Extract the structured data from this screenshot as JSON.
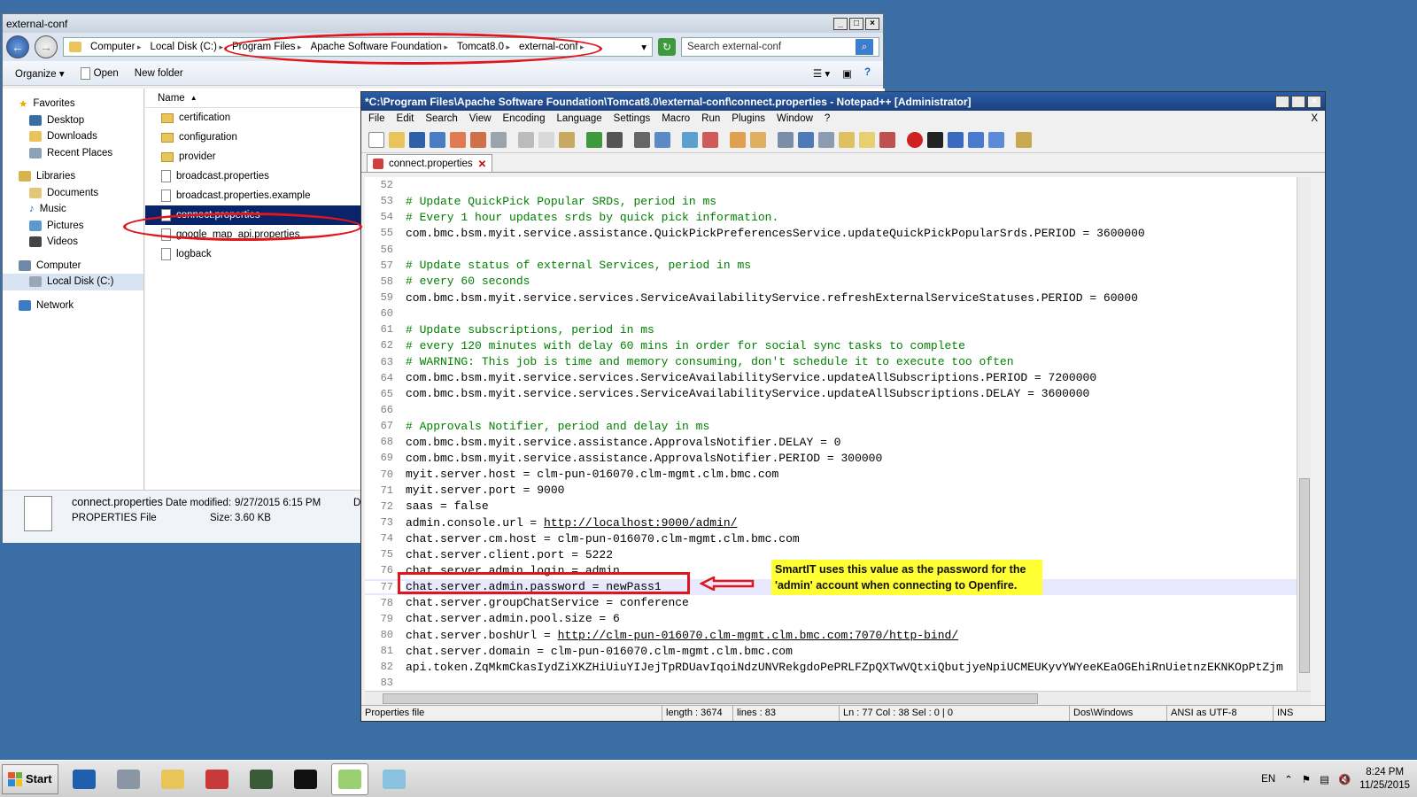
{
  "explorer": {
    "title": "external-conf",
    "breadcrumb": [
      "Computer",
      "Local Disk (C:)",
      "Program Files",
      "Apache Software Foundation",
      "Tomcat8.0",
      "external-conf"
    ],
    "search_placeholder": "Search external-conf",
    "commands": {
      "organize": "Organize ▾",
      "open": "Open",
      "new_folder": "New folder"
    },
    "nav": {
      "favorites": "Favorites",
      "desktop": "Desktop",
      "downloads": "Downloads",
      "recent": "Recent Places",
      "libraries": "Libraries",
      "documents": "Documents",
      "music": "Music",
      "pictures": "Pictures",
      "videos": "Videos",
      "computer": "Computer",
      "local_disk": "Local Disk (C:)",
      "network": "Network"
    },
    "column_name": "Name",
    "files": [
      {
        "name": "certification",
        "kind": "folder"
      },
      {
        "name": "configuration",
        "kind": "folder"
      },
      {
        "name": "provider",
        "kind": "folder"
      },
      {
        "name": "broadcast.properties",
        "kind": "doc"
      },
      {
        "name": "broadcast.properties.example",
        "kind": "doc"
      },
      {
        "name": "connect.properties",
        "kind": "doc"
      },
      {
        "name": "google_map_api.properties",
        "kind": "doc"
      },
      {
        "name": "logback",
        "kind": "doc"
      }
    ],
    "details": {
      "filename": "connect.properties",
      "date_label": "Date modified:",
      "date_value": "9/27/2015 6:15 PM",
      "type": "PROPERTIES File",
      "size_label": "Size:",
      "size_value": "3.60 KB",
      "extra": "D"
    }
  },
  "notepad": {
    "title": "*C:\\Program Files\\Apache Software Foundation\\Tomcat8.0\\external-conf\\connect.properties - Notepad++ [Administrator]",
    "menus": [
      "File",
      "Edit",
      "Search",
      "View",
      "Encoding",
      "Language",
      "Settings",
      "Macro",
      "Run",
      "Plugins",
      "Window",
      "?"
    ],
    "menu_close": "X",
    "tab_label": "connect.properties",
    "lines": [
      {
        "n": "52",
        "t": "",
        "c": false
      },
      {
        "n": "53",
        "t": "# Update QuickPick Popular SRDs, period in ms",
        "c": true
      },
      {
        "n": "54",
        "t": "# Every 1 hour updates srds by quick pick information.",
        "c": true
      },
      {
        "n": "55",
        "t": "com.bmc.bsm.myit.service.assistance.QuickPickPreferencesService.updateQuickPickPopularSrds.PERIOD = 3600000",
        "c": false
      },
      {
        "n": "56",
        "t": "",
        "c": false
      },
      {
        "n": "57",
        "t": "# Update status of external Services, period in ms",
        "c": true
      },
      {
        "n": "58",
        "t": "# every 60 seconds",
        "c": true
      },
      {
        "n": "59",
        "t": "com.bmc.bsm.myit.service.services.ServiceAvailabilityService.refreshExternalServiceStatuses.PERIOD = 60000",
        "c": false
      },
      {
        "n": "60",
        "t": "",
        "c": false
      },
      {
        "n": "61",
        "t": "# Update subscriptions, period in ms",
        "c": true
      },
      {
        "n": "62",
        "t": "# every 120 minutes with delay 60 mins in order for social sync tasks to complete",
        "c": true
      },
      {
        "n": "63",
        "t": "# WARNING: This job is time and memory consuming, don't schedule it to execute too often",
        "c": true
      },
      {
        "n": "64",
        "t": "com.bmc.bsm.myit.service.services.ServiceAvailabilityService.updateAllSubscriptions.PERIOD = 7200000",
        "c": false
      },
      {
        "n": "65",
        "t": "com.bmc.bsm.myit.service.services.ServiceAvailabilityService.updateAllSubscriptions.DELAY = 3600000",
        "c": false
      },
      {
        "n": "66",
        "t": "",
        "c": false
      },
      {
        "n": "67",
        "t": "# Approvals Notifier, period and delay in ms",
        "c": true
      },
      {
        "n": "68",
        "t": "com.bmc.bsm.myit.service.assistance.ApprovalsNotifier.DELAY = 0",
        "c": false
      },
      {
        "n": "69",
        "t": "com.bmc.bsm.myit.service.assistance.ApprovalsNotifier.PERIOD = 300000",
        "c": false
      },
      {
        "n": "70",
        "t": "myit.server.host = clm-pun-016070.clm-mgmt.clm.bmc.com",
        "c": false
      },
      {
        "n": "71",
        "t": "myit.server.port = 9000",
        "c": false
      },
      {
        "n": "72",
        "t": "saas = false",
        "c": false
      },
      {
        "n": "73",
        "t": "admin.console.url = http://localhost:9000/admin/",
        "c": false
      },
      {
        "n": "74",
        "t": "chat.server.cm.host = clm-pun-016070.clm-mgmt.clm.bmc.com",
        "c": false
      },
      {
        "n": "75",
        "t": "chat.server.client.port = 5222",
        "c": false
      },
      {
        "n": "76",
        "t": "chat.server.admin.login = admin",
        "c": false
      },
      {
        "n": "77",
        "t": "chat.server.admin.password = newPass1",
        "c": false
      },
      {
        "n": "78",
        "t": "chat.server.groupChatService = conference",
        "c": false
      },
      {
        "n": "79",
        "t": "chat.server.admin.pool.size = 6",
        "c": false
      },
      {
        "n": "80",
        "t": "chat.server.boshUrl = http://clm-pun-016070.clm-mgmt.clm.bmc.com:7070/http-bind/",
        "c": false
      },
      {
        "n": "81",
        "t": "chat.server.domain = clm-pun-016070.clm-mgmt.clm.bmc.com",
        "c": false
      },
      {
        "n": "82",
        "t": "api.token.ZqMkmCkasIydZiXKZHiUiuYIJejTpRDUavIqoiNdzUNVRekgdoPePRLFZpQXTwVQtxiQbutjyeNpiUCMEUKyvYWYeeKEaOGEhiRnUietnzEKNKOpPtZjm",
        "c": false
      },
      {
        "n": "83",
        "t": "",
        "c": false
      }
    ],
    "status": {
      "type": "Properties file",
      "length": "length : 3674",
      "lines": "lines : 83",
      "pos": "Ln : 77    Col : 38    Sel : 0 | 0",
      "eol": "Dos\\Windows",
      "enc": "ANSI as UTF-8",
      "mode": "INS"
    }
  },
  "annotation": "SmartIT uses this value as the password for the 'admin' account when connecting to Openfire.",
  "taskbar": {
    "start": "Start",
    "lang": "EN",
    "time": "8:24 PM",
    "date": "11/25/2015"
  }
}
